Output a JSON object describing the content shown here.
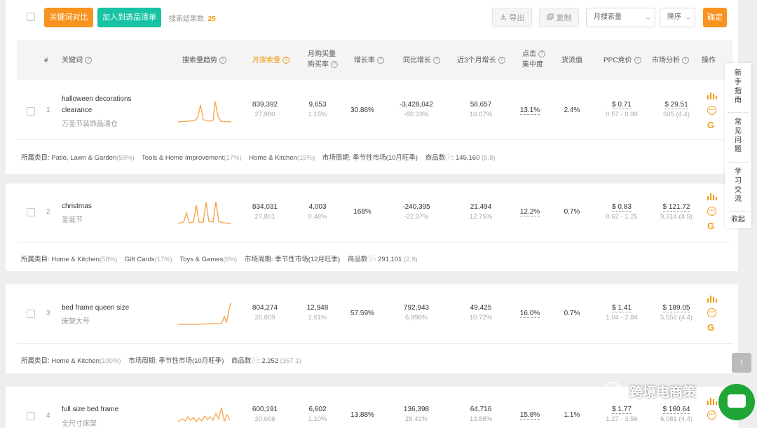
{
  "toolbar": {
    "compare_label": "关键词对比",
    "add_label": "加入到选品清单",
    "result_label": "搜索结果数:",
    "result_count": "25",
    "export_label": "导出",
    "copy_label": "复制",
    "sort_field": "月搜索量",
    "sort_order": "降序",
    "confirm_label": "确定"
  },
  "columns": {
    "index": "#",
    "keyword": "关键词",
    "trend": "搜索量趋势",
    "monthly_search": "月搜索量",
    "purchase_line1": "月购买量",
    "purchase_line2": "购买率",
    "growth": "增长率",
    "yoy": "同比增长",
    "three_month": "近3个月增长",
    "click_line1": "点击",
    "click_line2": "集中度",
    "supply": "货流值",
    "ppc": "PPC竞价",
    "market": "市场分析",
    "ops": "操作"
  },
  "rows": [
    {
      "index": "1",
      "keyword": "halloween decorations clearance",
      "keyword_cn": "万圣节装饰品清仓",
      "search_volume": "839,392",
      "search_sub": "27,980",
      "purchases": "9,653",
      "purchase_rate": "1.15%",
      "growth": "30.86%",
      "yoy": "-3,428,042",
      "yoy_pct": "-80.33%",
      "three_month": "58,657",
      "three_month_pct": "10.07%",
      "click": "13.1%",
      "supply": "2.4%",
      "ppc": "$ 0.71",
      "ppc_range": "0.57 - 0.99",
      "market": "$ 29.51",
      "market_sub": "505 (4.4)",
      "meta": {
        "label": "所属类目:",
        "cats": [
          {
            "name": "Patio, Lawn & Garden",
            "pct": "(58%)"
          },
          {
            "name": "Tools & Home Improvement",
            "pct": "(17%)"
          },
          {
            "name": "Home & Kitchen",
            "pct": "(15%)"
          }
        ],
        "cycle": "市场周期: 季节性市场(10月旺季)",
        "goods_label": "商品数",
        "goods": ": 145,160",
        "goods_sub": "(5.8)"
      }
    },
    {
      "index": "2",
      "keyword": "christmas",
      "keyword_cn": "圣诞节",
      "search_volume": "834,031",
      "search_sub": "27,801",
      "purchases": "4,003",
      "purchase_rate": "0.48%",
      "growth": "168%",
      "yoy": "-240,395",
      "yoy_pct": "-22.37%",
      "three_month": "21,494",
      "three_month_pct": "12.75%",
      "click": "12.2%",
      "supply": "0.7%",
      "ppc": "$ 0.83",
      "ppc_range": "0.62 - 1.25",
      "market": "$ 121.72",
      "market_sub": "9,314 (4.5)",
      "meta": {
        "label": "所属类目:",
        "cats": [
          {
            "name": "Home & Kitchen",
            "pct": "(58%)"
          },
          {
            "name": "Gift Cards",
            "pct": "(17%)"
          },
          {
            "name": "Toys & Games",
            "pct": "(6%)"
          }
        ],
        "cycle": "市场周期: 季节性市场(12月旺季)",
        "goods_label": "商品数",
        "goods": ": 291,101",
        "goods_sub": "(2.9)"
      }
    },
    {
      "index": "3",
      "keyword": "bed frame queen size",
      "keyword_cn": "床架大号",
      "search_volume": "804,274",
      "search_sub": "26,809",
      "purchases": "12,948",
      "purchase_rate": "1.61%",
      "growth": "57.59%",
      "yoy": "792,943",
      "yoy_pct": "6,998%",
      "three_month": "49,425",
      "three_month_pct": "10.72%",
      "click": "16.0%",
      "supply": "0.7%",
      "ppc": "$ 1.41",
      "ppc_range": "1.04 - 2.84",
      "market": "$ 189.05",
      "market_sub": "5,556 (4.4)",
      "meta": {
        "label": "所属类目:",
        "cats": [
          {
            "name": "Home & Kitchen",
            "pct": "(100%)"
          }
        ],
        "cycle": "市场周期: 季节性市场(10月旺季)",
        "goods_label": "商品数",
        "goods": ": 2,252",
        "goods_sub": "(357.1)"
      }
    },
    {
      "index": "4",
      "keyword": "full size bed frame",
      "keyword_cn": "全尺寸床架",
      "search_volume": "600,191",
      "search_sub": "20,006",
      "purchases": "6,602",
      "purchase_rate": "1.10%",
      "growth": "13.88%",
      "yoy": "136,398",
      "yoy_pct": "29.41%",
      "three_month": "64,716",
      "three_month_pct": "13.88%",
      "click": "15.8%",
      "supply": "1.1%",
      "ppc": "$ 1.77",
      "ppc_range": "1.27 - 3.56",
      "market": "$ 160.64",
      "market_sub": "6,081 (4.4)"
    }
  ],
  "side": {
    "items": [
      "新手指南",
      "常见问题",
      "学习交流",
      "收起"
    ]
  },
  "watermark": "跨境电商策",
  "icons": {
    "bar": "bar-chart-icon",
    "circle": "ellipsis-circle-icon",
    "g": "google-icon",
    "export": "download-icon",
    "copy": "copy-icon",
    "up": "arrow-up-icon",
    "chat": "chat-icon"
  },
  "colors": {
    "accent": "#f39c12",
    "button_orange": "#f7931e",
    "button_teal": "#17c3a4",
    "trend_line": "#f5a142"
  }
}
